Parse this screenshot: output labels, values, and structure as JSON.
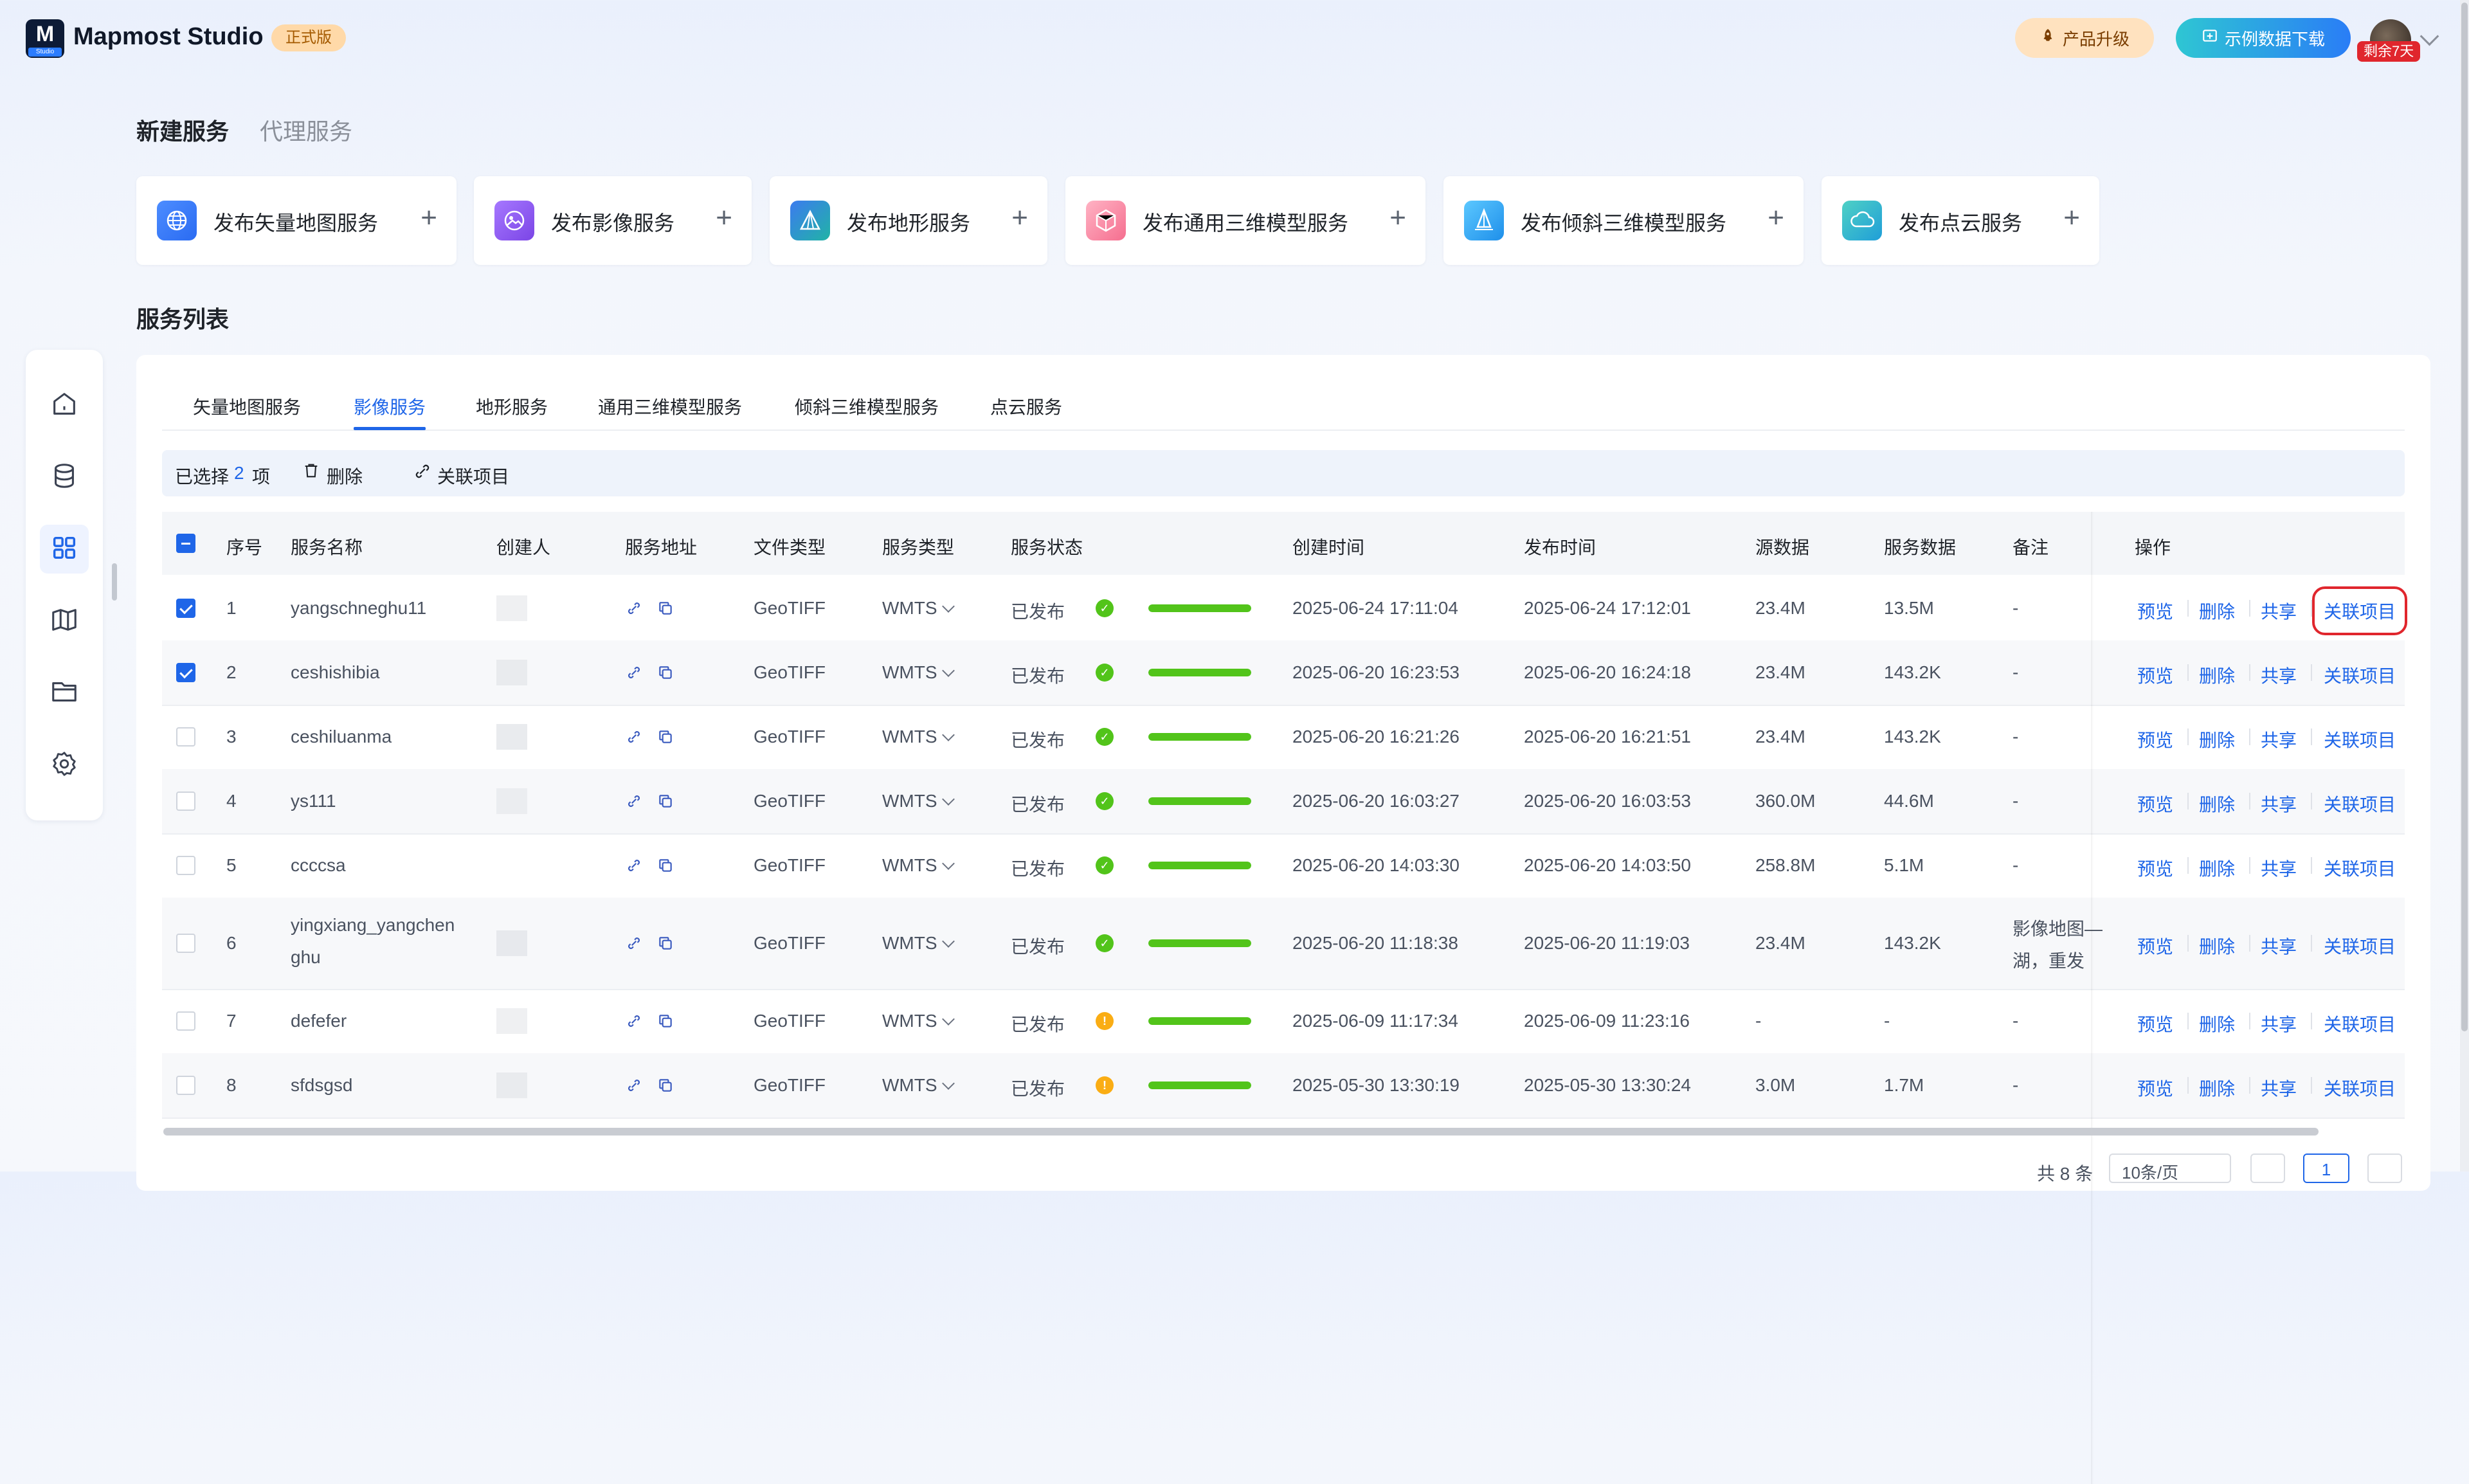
{
  "header": {
    "app_name": "Mapmost Studio",
    "logo_letter": "M",
    "logo_sub": "Studio",
    "edition": "正式版",
    "upgrade_label": "产品升级",
    "download_label": "示例数据下载",
    "trial_badge": "剩余7天"
  },
  "section_tabs": [
    {
      "label": "新建服务",
      "active": true
    },
    {
      "label": "代理服务",
      "active": false
    }
  ],
  "publish_cards": [
    {
      "label": "发布矢量地图服务",
      "icon": "globe-icon",
      "color": "#3a7bff"
    },
    {
      "label": "发布影像服务",
      "icon": "image-icon",
      "color": "#8a56f0"
    },
    {
      "label": "发布地形服务",
      "icon": "terrain-icon",
      "color": "#2a67e0"
    },
    {
      "label": "发布通用三维模型服务",
      "icon": "cube-icon",
      "color": "#f56e8f"
    },
    {
      "label": "发布倾斜三维模型服务",
      "icon": "tilt-model-icon",
      "color": "#27a8ef"
    },
    {
      "label": "发布点云服务",
      "icon": "cloud-icon",
      "color": "#20b5c9"
    }
  ],
  "list_title": "服务列表",
  "sidebar": [
    {
      "icon": "home-icon",
      "active": false
    },
    {
      "icon": "database-icon",
      "active": false
    },
    {
      "icon": "grid-icon",
      "active": true
    },
    {
      "icon": "map-icon",
      "active": false
    },
    {
      "icon": "folder-icon",
      "active": false
    },
    {
      "icon": "settings-icon",
      "active": false
    }
  ],
  "type_tabs": [
    {
      "label": "矢量地图服务",
      "active": false
    },
    {
      "label": "影像服务",
      "active": true
    },
    {
      "label": "地形服务",
      "active": false
    },
    {
      "label": "通用三维模型服务",
      "active": false
    },
    {
      "label": "倾斜三维模型服务",
      "active": false
    },
    {
      "label": "点云服务",
      "active": false
    }
  ],
  "selection_bar": {
    "prefix": "已选择",
    "count": "2",
    "suffix": "项",
    "delete_label": "删除",
    "link_label": "关联项目"
  },
  "table": {
    "columns": [
      "序号",
      "服务名称",
      "创建人",
      "服务地址",
      "文件类型",
      "服务类型",
      "服务状态",
      "创建时间",
      "发布时间",
      "源数据",
      "服务数据",
      "备注",
      "操作"
    ],
    "actions": [
      "预览",
      "删除",
      "共享",
      "关联项目"
    ],
    "rows": [
      {
        "no": "1",
        "name": "yangschneghu11",
        "file_type": "GeoTIFF",
        "service_type": "WMTS",
        "status": "已发布",
        "status_kind": "success",
        "progress": 1.0,
        "created": "2025-06-24 17:11:04",
        "published": "2025-06-24 17:12:01",
        "source": "23.4M",
        "service_data": "13.5M",
        "note": "-",
        "checked": true
      },
      {
        "no": "2",
        "name": "ceshishibia",
        "file_type": "GeoTIFF",
        "service_type": "WMTS",
        "status": "已发布",
        "status_kind": "success",
        "progress": 1.0,
        "created": "2025-06-20 16:23:53",
        "published": "2025-06-20 16:24:18",
        "source": "23.4M",
        "service_data": "143.2K",
        "note": "-",
        "checked": true
      },
      {
        "no": "3",
        "name": "ceshiluanma",
        "file_type": "GeoTIFF",
        "service_type": "WMTS",
        "status": "已发布",
        "status_kind": "success",
        "progress": 1.0,
        "created": "2025-06-20 16:21:26",
        "published": "2025-06-20 16:21:51",
        "source": "23.4M",
        "service_data": "143.2K",
        "note": "-",
        "checked": false
      },
      {
        "no": "4",
        "name": "ys111",
        "file_type": "GeoTIFF",
        "service_type": "WMTS",
        "status": "已发布",
        "status_kind": "success",
        "progress": 1.0,
        "created": "2025-06-20 16:03:27",
        "published": "2025-06-20 16:03:53",
        "source": "360.0M",
        "service_data": "44.6M",
        "note": "-",
        "checked": false
      },
      {
        "no": "5",
        "name": "ccccsa",
        "file_type": "GeoTIFF",
        "service_type": "WMTS",
        "status": "已发布",
        "status_kind": "success",
        "progress": 1.0,
        "created": "2025-06-20 14:03:30",
        "published": "2025-06-20 14:03:50",
        "source": "258.8M",
        "service_data": "5.1M",
        "note": "-",
        "checked": false
      },
      {
        "no": "6",
        "name": "yingxiang_yangchen",
        "name2": "ghu",
        "file_type": "GeoTIFF",
        "service_type": "WMTS",
        "status": "已发布",
        "status_kind": "success",
        "progress": 1.0,
        "created": "2025-06-20 11:18:38",
        "published": "2025-06-20 11:19:03",
        "source": "23.4M",
        "service_data": "143.2K",
        "note": "影像地图—",
        "note2": "湖，重发",
        "checked": false
      },
      {
        "no": "7",
        "name": "defefer",
        "file_type": "GeoTIFF",
        "service_type": "WMTS",
        "status": "已发布",
        "status_kind": "warning",
        "progress": 1.0,
        "created": "2025-06-09 11:17:34",
        "published": "2025-06-09 11:23:16",
        "source": "-",
        "service_data": "-",
        "note": "-",
        "checked": false
      },
      {
        "no": "8",
        "name": "sfdsgsd",
        "file_type": "GeoTIFF",
        "service_type": "WMTS",
        "status": "已发布",
        "status_kind": "warning",
        "progress": 1.0,
        "created": "2025-05-30 13:30:19",
        "published": "2025-05-30 13:30:24",
        "source": "3.0M",
        "service_data": "1.7M",
        "note": "-",
        "checked": false
      }
    ]
  },
  "footer": {
    "total": "共 8 条",
    "page_size": "10条/页",
    "current_page": "1"
  },
  "colors": {
    "accent": "#1f66e8",
    "success": "#52c41a",
    "warning": "#faad14",
    "highlight": "#e0262d"
  }
}
